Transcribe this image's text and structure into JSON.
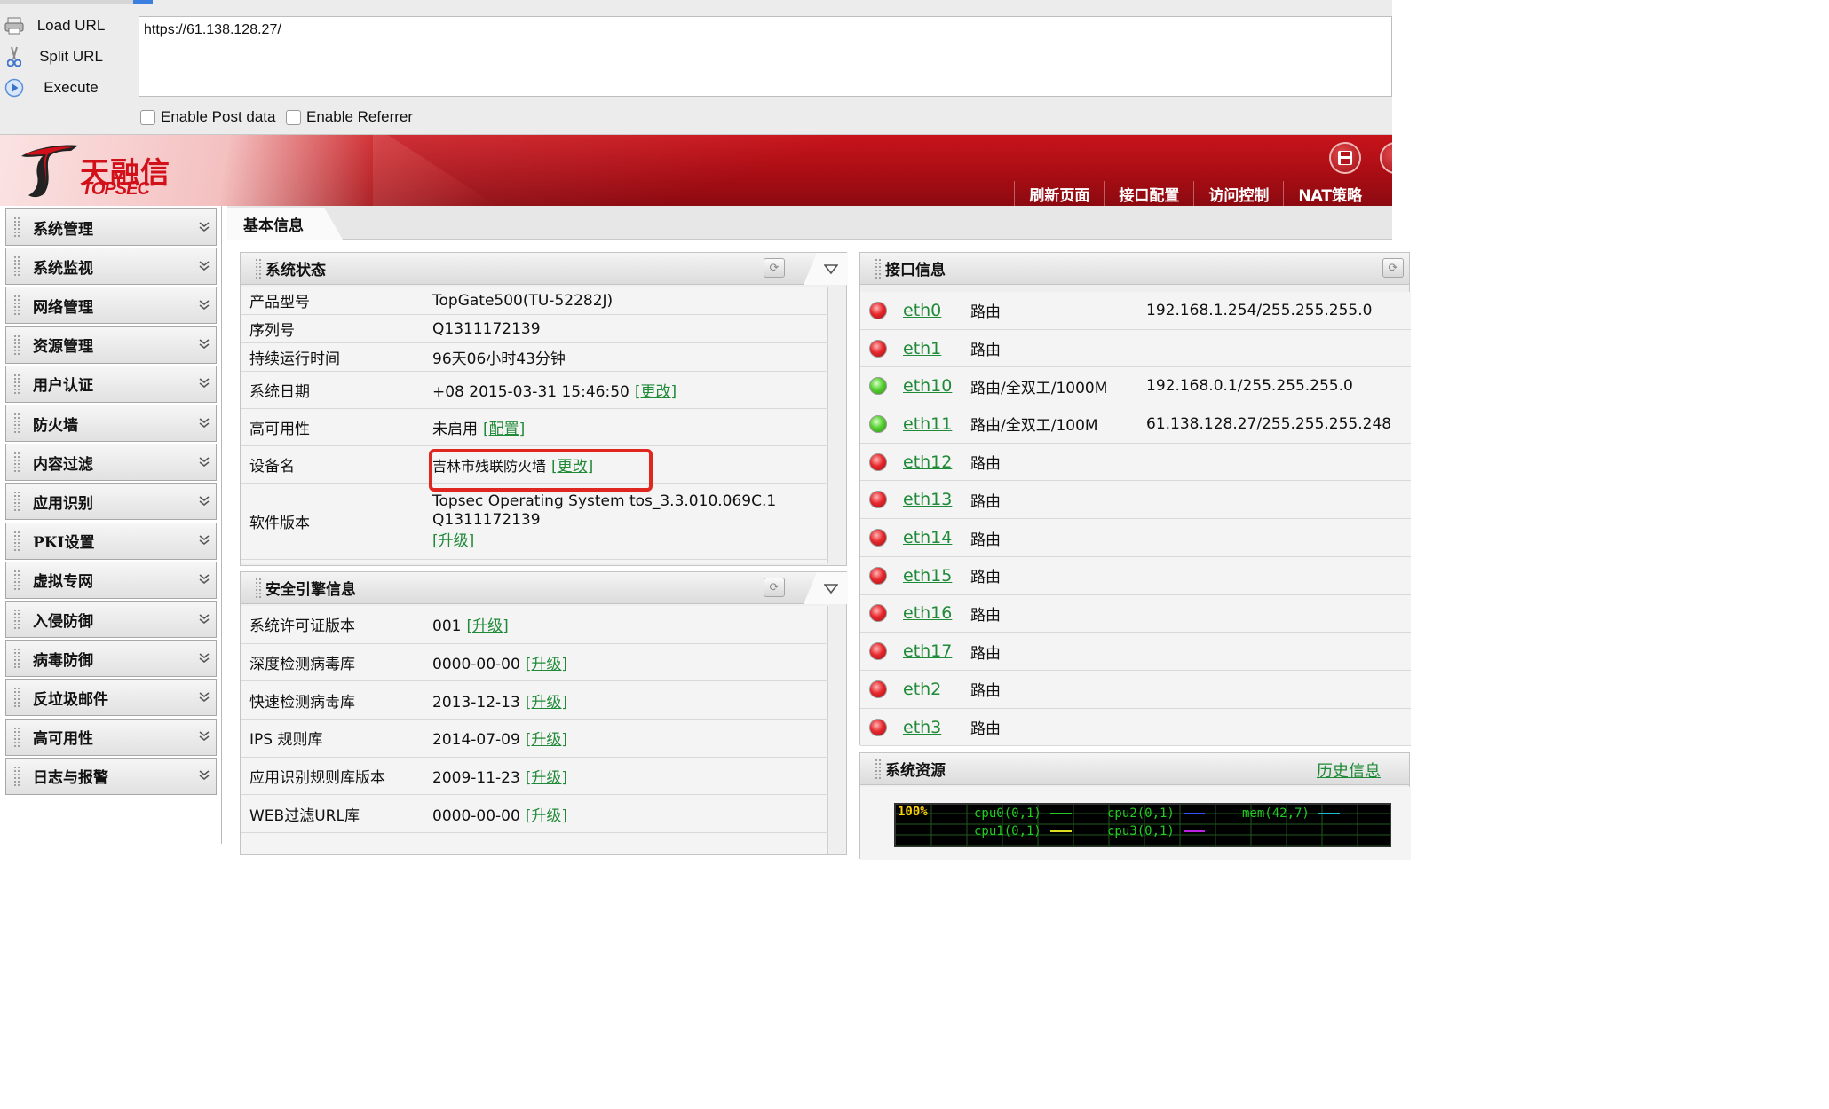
{
  "hackbar": {
    "buttons": [
      {
        "label": "Load URL"
      },
      {
        "label": "Split URL"
      },
      {
        "label": "Execute"
      }
    ],
    "url": "https://61.138.128.27/",
    "checkboxes": [
      {
        "label": "Enable Post data"
      },
      {
        "label": "Enable Referrer"
      }
    ]
  },
  "header": {
    "logo_cn": "天融信",
    "logo_en": "TOPSEC",
    "nav": [
      "刷新页面",
      "接口配置",
      "访问控制",
      "NAT策略"
    ]
  },
  "sidebar": {
    "items": [
      {
        "label": "系统管理"
      },
      {
        "label": "系统监视"
      },
      {
        "label": "网络管理"
      },
      {
        "label": "资源管理"
      },
      {
        "label": "用户认证"
      },
      {
        "label": "防火墙"
      },
      {
        "label": "内容过滤"
      },
      {
        "label": "应用识别"
      },
      {
        "label": "PKI设置"
      },
      {
        "label": "虚拟专网"
      },
      {
        "label": "入侵防御"
      },
      {
        "label": "病毒防御"
      },
      {
        "label": "反垃圾邮件"
      },
      {
        "label": "高可用性"
      },
      {
        "label": "日志与报警"
      }
    ]
  },
  "main": {
    "tab": "基本信息",
    "system_status": {
      "title": "系统状态",
      "rows": [
        {
          "key": "产品型号",
          "value": "TopGate500(TU-52282J)"
        },
        {
          "key": "序列号",
          "value": "Q1311172139"
        },
        {
          "key": "持续运行时间",
          "value": "96天06小时43分钟"
        },
        {
          "key": "系统日期",
          "value": "+08 2015-03-31 15:46:50",
          "link": "[更改]"
        },
        {
          "key": "高可用性",
          "value": "未启用",
          "link": "[配置]"
        },
        {
          "key": "设备名",
          "value": "吉林市残联防火墙",
          "link": "[更改]"
        },
        {
          "key": "软件版本",
          "value": "Topsec Operating System tos_3.3.010.069C.1",
          "value2": "Q1311172139",
          "link": "[升级]"
        }
      ]
    },
    "security_engine": {
      "title": "安全引擎信息",
      "rows": [
        {
          "key": "系统许可证版本",
          "value": "001",
          "link": "[升级]"
        },
        {
          "key": "深度检测病毒库",
          "value": "0000-00-00",
          "link": "[升级]"
        },
        {
          "key": "快速检测病毒库",
          "value": "2013-12-13",
          "link": "[升级]"
        },
        {
          "key": "IPS 规则库",
          "value": "2014-07-09",
          "link": "[升级]"
        },
        {
          "key": "应用识别规则库版本",
          "value": "2009-11-23",
          "link": "[升级]"
        },
        {
          "key": "WEB过滤URL库",
          "value": "0000-00-00",
          "link": "[升级]"
        }
      ]
    },
    "interfaces": {
      "title": "接口信息",
      "rows": [
        {
          "name": "eth0",
          "mode": "路由",
          "ip": "192.168.1.254/255.255.255.0",
          "status": "red"
        },
        {
          "name": "eth1",
          "mode": "路由",
          "ip": "",
          "status": "red"
        },
        {
          "name": "eth10",
          "mode": "路由/全双工/1000M",
          "ip": "192.168.0.1/255.255.255.0",
          "status": "green"
        },
        {
          "name": "eth11",
          "mode": "路由/全双工/100M",
          "ip": "61.138.128.27/255.255.255.248",
          "status": "green"
        },
        {
          "name": "eth12",
          "mode": "路由",
          "ip": "",
          "status": "red"
        },
        {
          "name": "eth13",
          "mode": "路由",
          "ip": "",
          "status": "red"
        },
        {
          "name": "eth14",
          "mode": "路由",
          "ip": "",
          "status": "red"
        },
        {
          "name": "eth15",
          "mode": "路由",
          "ip": "",
          "status": "red"
        },
        {
          "name": "eth16",
          "mode": "路由",
          "ip": "",
          "status": "red"
        },
        {
          "name": "eth17",
          "mode": "路由",
          "ip": "",
          "status": "red"
        },
        {
          "name": "eth2",
          "mode": "路由",
          "ip": "",
          "status": "red"
        },
        {
          "name": "eth3",
          "mode": "路由",
          "ip": "",
          "status": "red"
        }
      ]
    },
    "system_resources": {
      "title": "系统资源",
      "history_link": "历史信息",
      "graph": {
        "max_label": "100%",
        "legend": [
          {
            "label": "cpu0(0,1)",
            "color": "#22cc22"
          },
          {
            "label": "cpu2(0,1)",
            "color": "#3355ff"
          },
          {
            "label": "mem(42,7)",
            "color": "#22bbcc"
          },
          {
            "label": "cpu1(0,1)",
            "color": "#dddd22"
          },
          {
            "label": "cpu3(0,1)",
            "color": "#bb22dd"
          }
        ]
      }
    }
  },
  "colors": {
    "brand_red": "#c8141b",
    "link_green": "#1f8a37",
    "highlight": "#e0271f"
  }
}
